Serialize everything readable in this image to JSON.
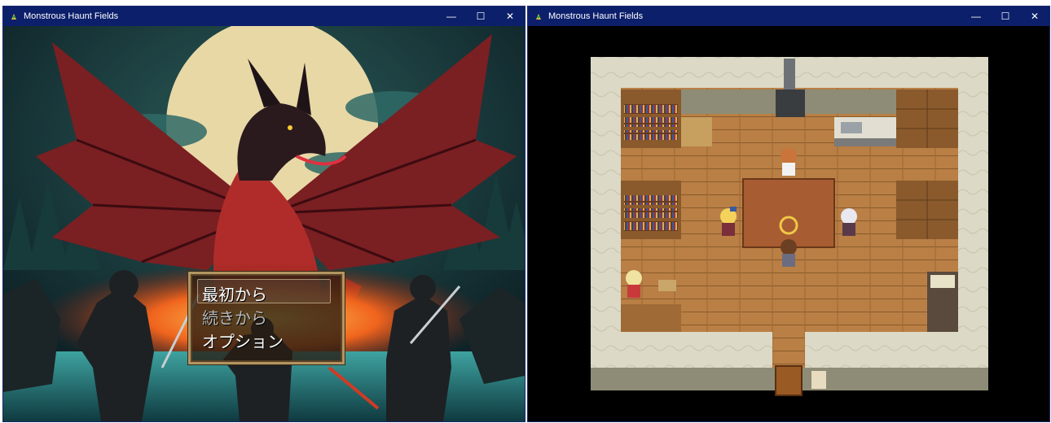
{
  "windows": [
    {
      "id": "title_screen",
      "title": "Monstrous Haunt Fields",
      "controls": {
        "minimize": "—",
        "maximize": "☐",
        "close": "✕"
      }
    },
    {
      "id": "game_map",
      "title": "Monstrous Haunt Fields",
      "controls": {
        "minimize": "—",
        "maximize": "☐",
        "close": "✕"
      }
    }
  ],
  "title_menu": {
    "items": [
      {
        "label": "最初から",
        "enabled": true,
        "selected": true
      },
      {
        "label": "続きから",
        "enabled": false,
        "selected": false
      },
      {
        "label": "オプション",
        "enabled": true,
        "selected": false
      }
    ]
  },
  "map": {
    "characters": [
      {
        "name": "npc-orange-hair",
        "hair": "#c8743a",
        "clothes": "#f2f2f2"
      },
      {
        "name": "npc-blonde-blue-bow",
        "hair": "#f4d25c",
        "clothes": "#7a2f3a"
      },
      {
        "name": "npc-white-hair",
        "hair": "#e8e8f0",
        "clothes": "#5a3a4a"
      },
      {
        "name": "player-brown-hair",
        "hair": "#6b3f22",
        "clothes": "#6c6c80"
      },
      {
        "name": "npc-blonde-red",
        "hair": "#f0e2a0",
        "clothes": "#c83a3a"
      }
    ],
    "colors": {
      "floor": "#b77d44",
      "wall": "#d9d6c2",
      "table": "#a85c32",
      "accent": "#e8c24a"
    }
  }
}
